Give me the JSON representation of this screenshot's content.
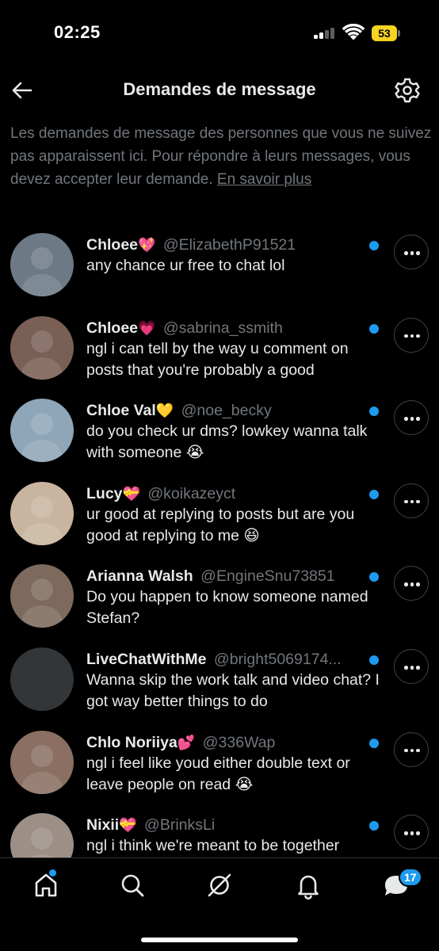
{
  "status_bar": {
    "time": "02:25",
    "battery": "53"
  },
  "header": {
    "title": "Demandes de message",
    "back_icon": "arrow-left-icon",
    "settings_icon": "gear-icon"
  },
  "info": {
    "text": "Les demandes de message des personnes que vous ne suivez pas apparaissent ici. Pour répondre à leurs messages, vous devez accepter leur demande.",
    "link": "En savoir plus"
  },
  "requests": [
    {
      "name": "Chloee",
      "emoji": "💖",
      "handle": "@ElizabethP91521",
      "message": "any chance ur free to chat lol",
      "unread": true,
      "avatar_color": "#6d7a86"
    },
    {
      "name": "Chloee",
      "emoji": "💗",
      "handle": "@sabrina_ssmith",
      "message": "ngl i can tell by the way u comment on posts that you're probably a good",
      "unread": true,
      "avatar_color": "#7a5f55"
    },
    {
      "name": "Chloe Val",
      "emoji": "💛",
      "handle": "@noe_becky",
      "message": "do you check ur dms? lowkey wanna talk with someone 😭",
      "unread": true,
      "avatar_color": "#8fa6b8"
    },
    {
      "name": "Lucy",
      "emoji": "💝",
      "handle": "@koikazeyct",
      "message": "ur good at replying to posts but are you good at replying to me 😆",
      "unread": true,
      "avatar_color": "#c9b59f"
    },
    {
      "name": "Arianna Walsh",
      "emoji": "",
      "handle": "@EngineSnu73851",
      "message": "Do you happen to know someone named Stefan?",
      "unread": true,
      "avatar_color": "#7d6a5c"
    },
    {
      "name": "LiveChatWithMe",
      "emoji": "",
      "handle": "@bright5069174...",
      "message": "Wanna skip the work talk and video chat? I got way better things to do",
      "unread": true,
      "avatar_color": "#333639"
    },
    {
      "name": "Chlo Noriiya",
      "emoji": "💕",
      "handle": "@336Wap",
      "message": "ngl i feel like youd either double text or leave people on read 😭",
      "unread": true,
      "avatar_color": "#8a6f62"
    },
    {
      "name": "Nixii",
      "emoji": "💝",
      "handle": "@BrinksLi",
      "message": "ngl i think we're meant to be together",
      "unread": true,
      "avatar_color": "#9b8f86"
    }
  ],
  "tabs": [
    {
      "id": "home",
      "icon": "home-icon"
    },
    {
      "id": "search",
      "icon": "search-icon"
    },
    {
      "id": "grok",
      "icon": "grok-icon"
    },
    {
      "id": "notifications",
      "icon": "bell-icon"
    },
    {
      "id": "messages",
      "icon": "messages-icon",
      "badge": "17"
    }
  ]
}
